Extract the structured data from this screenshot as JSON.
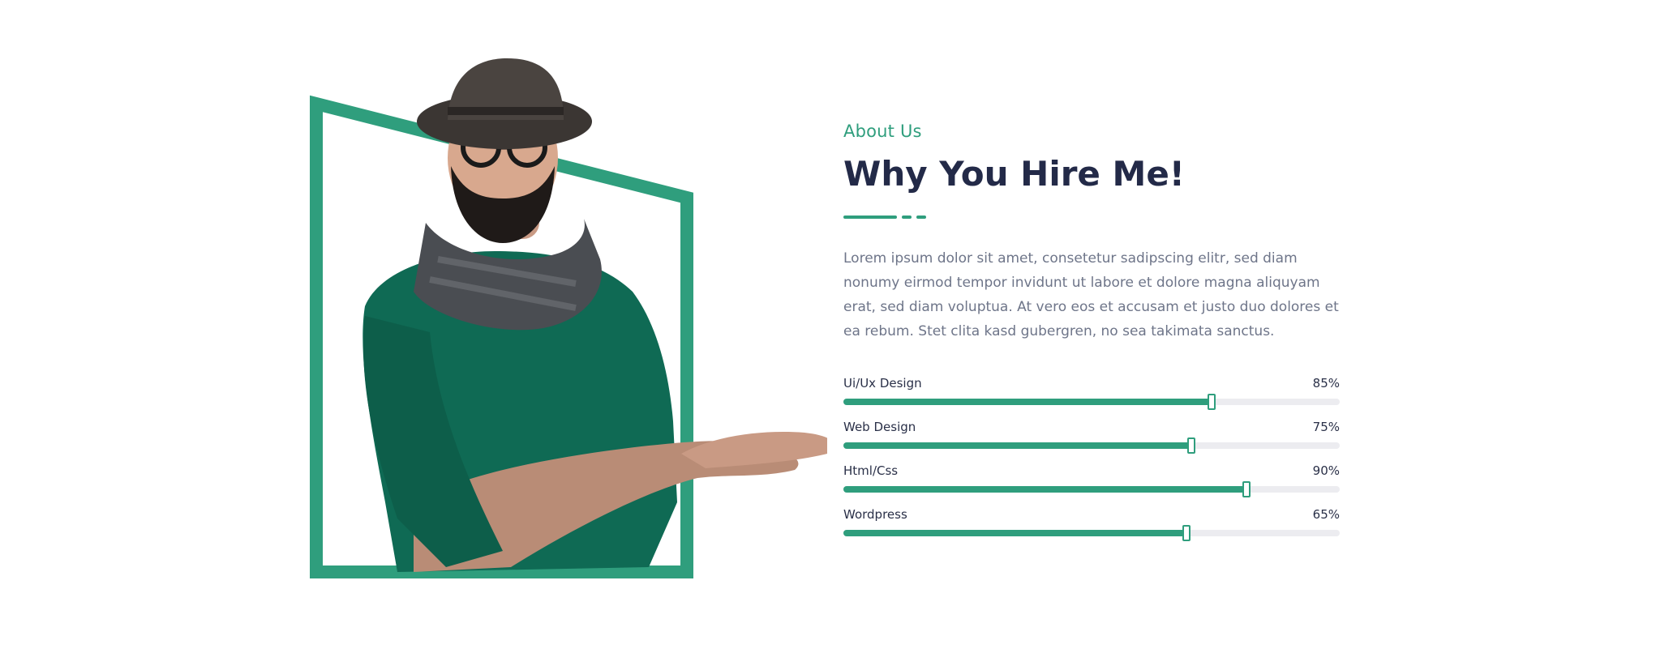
{
  "about": {
    "eyebrow": "About Us",
    "title": "Why You Hire Me!",
    "description": "Lorem ipsum dolor sit amet, consetetur sadipscing elitr, sed diam nonumy eirmod tempor invidunt ut labore et dolore magna aliquyam erat, sed diam voluptua. At vero eos et accusam et justo duo dolores et ea rebum. Stet clita kasd gubergren, no sea takimata sanctus."
  },
  "skills": [
    {
      "label": "Ui/Ux Design",
      "percent_label": "85%",
      "value": 0.74
    },
    {
      "label": "Web Design",
      "percent_label": "75%",
      "value": 0.7
    },
    {
      "label": "Html/Css",
      "percent_label": "90%",
      "value": 0.81
    },
    {
      "label": "Wordpress",
      "percent_label": "65%",
      "value": 0.69
    }
  ],
  "colors": {
    "accent": "#2f9e7d",
    "heading": "#232a48",
    "text": "#6e7589",
    "track": "#ececf0",
    "sweater": "#0f6a54"
  },
  "portrait": {
    "icon": "person-portrait-illustration"
  }
}
